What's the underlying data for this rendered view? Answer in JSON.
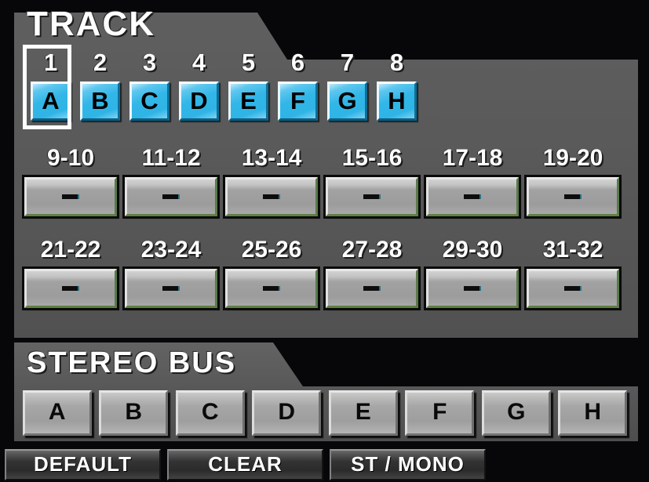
{
  "track_section": {
    "title": "TRACK",
    "numbers": [
      "1",
      "2",
      "3",
      "4",
      "5",
      "6",
      "7",
      "8"
    ],
    "buttons": [
      "A",
      "B",
      "C",
      "D",
      "E",
      "F",
      "G",
      "H"
    ],
    "selected_index": 0,
    "selected_color": "#32b6e8",
    "pair_rows": [
      {
        "labels": [
          "9-10",
          "11-12",
          "13-14",
          "15-16",
          "17-18",
          "19-20"
        ],
        "values": [
          "–",
          "–",
          "–",
          "–",
          "–",
          "–"
        ]
      },
      {
        "labels": [
          "21-22",
          "23-24",
          "25-26",
          "27-28",
          "29-30",
          "31-32"
        ],
        "values": [
          "–",
          "–",
          "–",
          "–",
          "–",
          "–"
        ]
      }
    ]
  },
  "stereo_section": {
    "title": "STEREO BUS",
    "buttons": [
      "A",
      "B",
      "C",
      "D",
      "E",
      "F",
      "G",
      "H"
    ]
  },
  "bottom_bar": {
    "buttons": [
      "DEFAULT",
      "CLEAR",
      "ST / MONO"
    ]
  },
  "theme": {
    "panel_bg": "#585858",
    "screen_bg": "#07070a",
    "accent_blue": "#32b6e8",
    "pair_edge_green": "#5f8044"
  }
}
